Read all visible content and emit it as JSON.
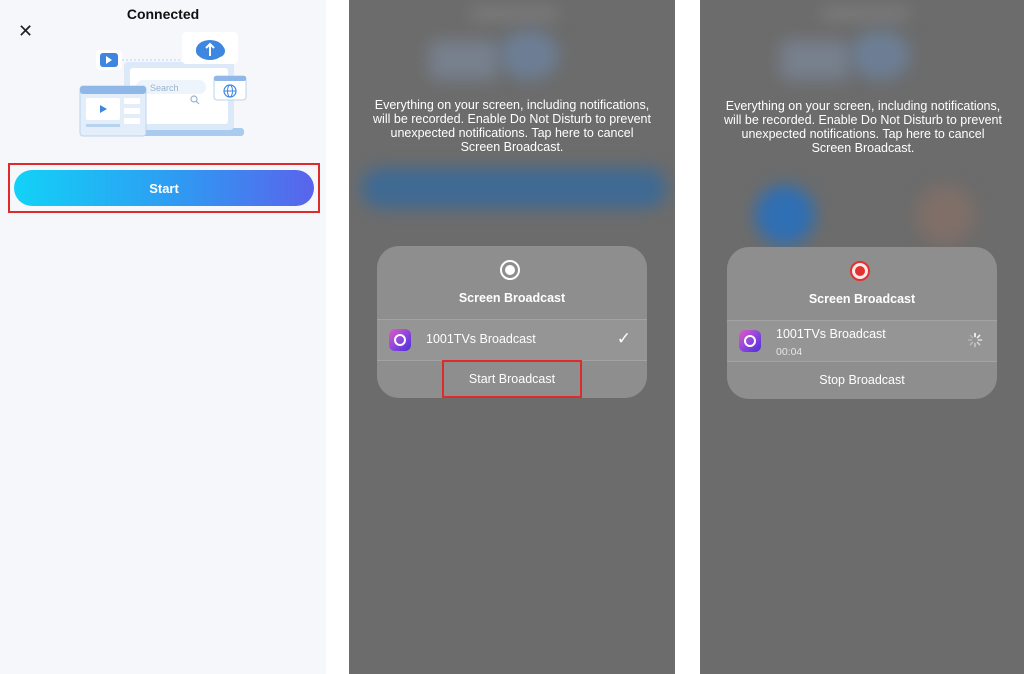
{
  "panel1": {
    "title": "Connected",
    "close_icon": "close-icon",
    "illustration": {
      "search_placeholder": "Search",
      "icons": [
        "play-icon",
        "cloud-upload-icon",
        "globe-icon",
        "search-icon"
      ]
    },
    "start_label": "Start",
    "start_gradient": [
      "#12d2f7",
      "#5a63ec"
    ]
  },
  "panel2": {
    "notice": "Everything on your screen, including notifications, will be recorded. Enable Do Not Disturb to prevent unexpected notifications. Tap here to cancel Screen Broadcast.",
    "card_title": "Screen Broadcast",
    "app_name": "1001TVs Broadcast",
    "check_icon": "checkmark-icon",
    "action_label": "Start Broadcast"
  },
  "panel3": {
    "notice": "Everything on your screen, including notifications, will be recorded. Enable Do Not Disturb to prevent unexpected notifications. Tap here to cancel Screen Broadcast.",
    "card_title": "Screen Broadcast",
    "app_name": "1001TVs Broadcast",
    "elapsed": "00:04",
    "spinner_icon": "loading-spinner-icon",
    "action_label": "Stop Broadcast"
  },
  "colors": {
    "highlight": "#e02a2a",
    "recording_red": "#e33030",
    "overlay_gray": "#6c6c6c"
  }
}
